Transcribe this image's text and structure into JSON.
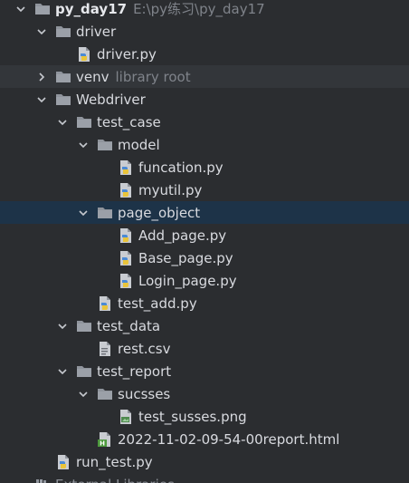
{
  "project_tree": {
    "nodes": [
      {
        "label": "py_day17",
        "hint": "E:\\py练习\\py_day17",
        "icon": "folder-icon",
        "arrow": "expanded",
        "depth": 0,
        "bold": true,
        "selected": false
      },
      {
        "label": "driver",
        "hint": "",
        "icon": "folder-icon",
        "arrow": "expanded",
        "depth": 1,
        "bold": false,
        "selected": false
      },
      {
        "label": "driver.py",
        "hint": "",
        "icon": "python-file-icon",
        "arrow": "none",
        "depth": 2,
        "bold": false,
        "selected": false
      },
      {
        "label": "venv",
        "hint": "library root",
        "icon": "folder-icon",
        "arrow": "collapsed",
        "depth": 1,
        "bold": false,
        "selected": false,
        "highlight": true
      },
      {
        "label": "Webdriver",
        "hint": "",
        "icon": "folder-icon",
        "arrow": "expanded",
        "depth": 1,
        "bold": false,
        "selected": false
      },
      {
        "label": "test_case",
        "hint": "",
        "icon": "folder-icon",
        "arrow": "expanded",
        "depth": 2,
        "bold": false,
        "selected": false
      },
      {
        "label": "model",
        "hint": "",
        "icon": "folder-icon",
        "arrow": "expanded",
        "depth": 3,
        "bold": false,
        "selected": false
      },
      {
        "label": "funcation.py",
        "hint": "",
        "icon": "python-file-icon",
        "arrow": "none",
        "depth": 4,
        "bold": false,
        "selected": false
      },
      {
        "label": "myutil.py",
        "hint": "",
        "icon": "python-file-icon",
        "arrow": "none",
        "depth": 4,
        "bold": false,
        "selected": false
      },
      {
        "label": "page_object",
        "hint": "",
        "icon": "folder-icon",
        "arrow": "expanded",
        "depth": 3,
        "bold": false,
        "selected": true
      },
      {
        "label": "Add_page.py",
        "hint": "",
        "icon": "python-file-icon",
        "arrow": "none",
        "depth": 4,
        "bold": false,
        "selected": false
      },
      {
        "label": "Base_page.py",
        "hint": "",
        "icon": "python-file-icon",
        "arrow": "none",
        "depth": 4,
        "bold": false,
        "selected": false
      },
      {
        "label": "Login_page.py",
        "hint": "",
        "icon": "python-file-icon",
        "arrow": "none",
        "depth": 4,
        "bold": false,
        "selected": false
      },
      {
        "label": "test_add.py",
        "hint": "",
        "icon": "python-file-icon",
        "arrow": "none",
        "depth": 3,
        "bold": false,
        "selected": false
      },
      {
        "label": "test_data",
        "hint": "",
        "icon": "folder-icon",
        "arrow": "expanded",
        "depth": 2,
        "bold": false,
        "selected": false
      },
      {
        "label": "rest.csv",
        "hint": "",
        "icon": "csv-file-icon",
        "arrow": "none",
        "depth": 3,
        "bold": false,
        "selected": false
      },
      {
        "label": "test_report",
        "hint": "",
        "icon": "folder-icon",
        "arrow": "expanded",
        "depth": 2,
        "bold": false,
        "selected": false
      },
      {
        "label": "sucsses",
        "hint": "",
        "icon": "folder-icon",
        "arrow": "expanded",
        "depth": 3,
        "bold": false,
        "selected": false
      },
      {
        "label": "test_susses.png",
        "hint": "",
        "icon": "image-file-icon",
        "arrow": "none",
        "depth": 4,
        "bold": false,
        "selected": false
      },
      {
        "label": "2022-11-02-09-54-00report.html",
        "hint": "",
        "icon": "html-file-icon",
        "arrow": "none",
        "depth": 3,
        "bold": false,
        "selected": false
      },
      {
        "label": "run_test.py",
        "hint": "",
        "icon": "python-file-icon",
        "arrow": "none",
        "depth": 1,
        "bold": false,
        "selected": false
      },
      {
        "label": "External Libraries",
        "hint": "",
        "icon": "library-icon",
        "arrow": "none",
        "depth": 0,
        "bold": false,
        "selected": false
      }
    ]
  }
}
